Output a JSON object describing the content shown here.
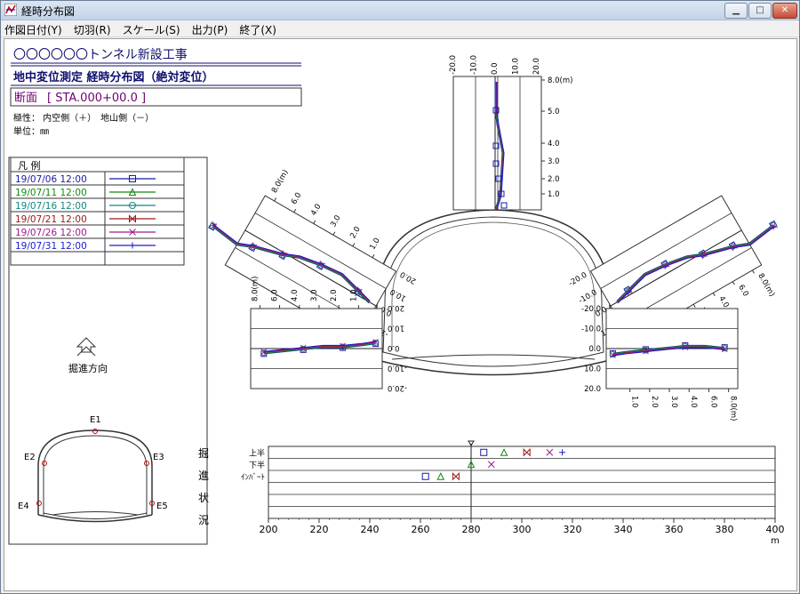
{
  "window": {
    "title": "経時分布図",
    "minimize": "▁",
    "maximize": "□",
    "close": "✕"
  },
  "menu": [
    "作図日付(Y)",
    "切羽(R)",
    "スケール(S)",
    "出力(P)",
    "終了(X)"
  ],
  "header": {
    "project": "〇〇〇〇〇〇トンネル新設工事",
    "subtitle": "地中変位測定 経時分布図（絶対変位）",
    "section_label": "断面",
    "section_value": "[ STA.000+00.0 ]",
    "polarity": "極性： 内空側（＋）　地山側（－）",
    "unit": "単位：㎜"
  },
  "legend": {
    "title": "凡 例",
    "rows": [
      {
        "date": "19/07/06 12:00",
        "color": "#1a1aa8",
        "marker": "square"
      },
      {
        "date": "19/07/11 12:00",
        "color": "#108a10",
        "marker": "triangle"
      },
      {
        "date": "19/07/16 12:00",
        "color": "#0f8a80",
        "marker": "circle"
      },
      {
        "date": "19/07/21 12:00",
        "color": "#a01818",
        "marker": "bowtie"
      },
      {
        "date": "19/07/26 12:00",
        "color": "#a01890",
        "marker": "x"
      },
      {
        "date": "19/07/31 12:00",
        "color": "#1a1ad0",
        "marker": "plus"
      }
    ]
  },
  "direction_label": "掘進方向",
  "sensors": [
    "E1",
    "E2",
    "E3",
    "E4",
    "E5"
  ],
  "excavation": {
    "side_chars": [
      "掘",
      "進",
      "状",
      "況"
    ],
    "rows": [
      "上半",
      "下半",
      "ｲﾝﾊﾞｰﾄ"
    ],
    "x_axis": {
      "min": 200,
      "max": 400,
      "step": 20,
      "unit": "m"
    },
    "current_face": 280,
    "marks": [
      {
        "row": 0,
        "x": 285,
        "series": 0
      },
      {
        "row": 0,
        "x": 293,
        "series": 1
      },
      {
        "row": 0,
        "x": 302,
        "series": 3
      },
      {
        "row": 0,
        "x": 311,
        "series": 4
      },
      {
        "row": 0,
        "x": 316,
        "series": 5
      },
      {
        "row": 1,
        "x": 280,
        "series": 1
      },
      {
        "row": 1,
        "x": 288,
        "series": 4
      },
      {
        "row": 2,
        "x": 262,
        "series": 0
      },
      {
        "row": 2,
        "x": 268,
        "series": 1
      },
      {
        "row": 2,
        "x": 274,
        "series": 3
      }
    ]
  },
  "panels": {
    "depth_ticks": [
      "1.0",
      "2.0",
      "3.0",
      "4.0",
      "6.0",
      "8.0(m)"
    ],
    "depth_ticks_bottom": [
      "1.0",
      "2.0",
      "3.0",
      "4.0",
      "6.0",
      "8.0(m)"
    ],
    "disp_ticks": [
      "-20.0",
      "-10.0",
      "0.0",
      "10.0",
      "20.0"
    ],
    "top_depth": [
      "1.0",
      "2.0",
      "3.0",
      "4.0",
      "5.0",
      "8.0(m)"
    ],
    "top_disp": [
      "-20.0",
      "-10.0",
      "0.0",
      "10.0",
      "20.0"
    ],
    "top": [
      [
        0,
        0
      ],
      [
        0.5,
        0.5
      ],
      [
        0.6,
        0.7
      ],
      [
        0.7,
        0.9
      ],
      [
        0.8,
        1.1
      ],
      [
        0.5,
        1.3
      ],
      [
        0.2,
        1.0
      ],
      [
        0,
        0.2
      ],
      [
        0,
        0.1
      ],
      [
        0,
        0
      ]
    ],
    "upper_left": [
      [
        1.2,
        -0.3
      ],
      [
        1.0,
        -0.4
      ],
      [
        0.9,
        -0.25
      ],
      [
        0.8,
        -0.15
      ],
      [
        0.7,
        -0.05
      ],
      [
        0.6,
        0.1
      ],
      [
        0.45,
        0.2
      ],
      [
        0.3,
        0.25
      ],
      [
        0.15,
        0.1
      ],
      [
        0.05,
        0
      ]
    ],
    "upper_right": [
      [
        1.2,
        -0.3
      ],
      [
        1.0,
        -0.4
      ],
      [
        0.9,
        -0.25
      ],
      [
        0.8,
        -0.15
      ],
      [
        0.7,
        -0.05
      ],
      [
        0.6,
        0.1
      ],
      [
        0.45,
        0.2
      ],
      [
        0.3,
        0.25
      ],
      [
        0.15,
        0.1
      ],
      [
        0.05,
        0
      ]
    ],
    "lower_left": [
      [
        0.05,
        0.15
      ],
      [
        0.15,
        0.1
      ],
      [
        0.3,
        0.05
      ],
      [
        0.45,
        0.05
      ],
      [
        0.6,
        0
      ],
      [
        0.75,
        -0.05
      ],
      [
        0.9,
        -0.1
      ]
    ],
    "lower_right": [
      [
        0.05,
        0.15
      ],
      [
        0.15,
        0.1
      ],
      [
        0.3,
        0.05
      ],
      [
        0.45,
        0.0
      ],
      [
        0.6,
        -0.05
      ],
      [
        0.75,
        -0.05
      ],
      [
        0.9,
        0.0
      ]
    ]
  }
}
